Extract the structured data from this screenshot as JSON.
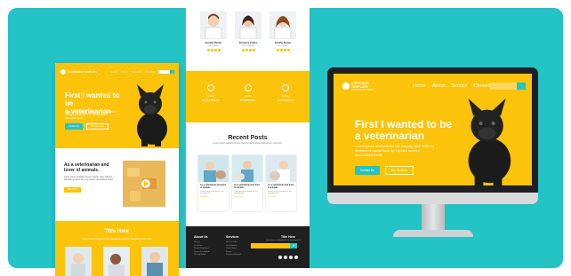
{
  "brand": {
    "name": "CUSTOMER TEMPLATE",
    "tagline": "VETERINARY CLINIC"
  },
  "nav": {
    "items": [
      "Home",
      "About",
      "Services",
      "Contact"
    ]
  },
  "hero": {
    "title_line1": "First I wanted to be",
    "title_line2": "a veterinarian",
    "description": "Lorem ipsum available but the majority have suffered alteration in some form, by injected humour randomised words",
    "primary_button": "Contact Us",
    "secondary_button": "Our Services"
  },
  "monitor_nav": {
    "items": [
      "Home",
      "About",
      "Service",
      "Contact"
    ]
  },
  "about": {
    "title_line1": "As a veterinarian and",
    "title_line2": "lover of animals.",
    "description": "Lorem ipsum available but the majority have suffered alteration in some form, by humour randomised words",
    "button": "Read More"
  },
  "services": {
    "title": "Title Here",
    "description": "Lorem ipsum available but the majority have suffered alteration in some form"
  },
  "team": [
    {
      "name": "Jennifer Becker",
      "role": "VETERINARY"
    },
    {
      "name": "Ginnanne Collins",
      "role": "VETERINARIAN"
    },
    {
      "name": "Jennifer Becker",
      "role": "VETERINARY"
    }
  ],
  "stats": [
    {
      "label": "CLIENT",
      "value": "Happy Clients"
    },
    {
      "label": "MEDIC",
      "value": "Experiences"
    },
    {
      "label": "PERFEC",
      "value": "Recruitment"
    }
  ],
  "posts": {
    "title": "Recent Posts",
    "subtitle": "Lorem ipsum available but the majority have suffered alteration in some form",
    "items": [
      {
        "title": "As a veterinarian and lover of animals",
        "text": "Lorem ipsum available but the majority have",
        "more": "Read More"
      },
      {
        "title": "As a veterinarian and lover of animals",
        "text": "Lorem ipsum available but the majority have",
        "more": "Read More"
      },
      {
        "title": "As a veterinarian and lover of animals",
        "text": "Lorem ipsum available but the majority have",
        "more": "Read More"
      }
    ]
  },
  "footer": {
    "col1_title": "About Us",
    "col1_items": [
      "History",
      "Our Team",
      "Brand Guidelines",
      "Terms & Condition",
      "Privacy Policy"
    ],
    "col2_title": "Services",
    "col2_items": [
      "How to Order",
      "Our Products",
      "Order Status",
      "Promo",
      "Payment Method"
    ],
    "col3_title": "Title Here",
    "col3_text": "Lorem ipsum available but the majority have"
  },
  "colors": {
    "accent": "#fbc30a",
    "teal": "#23c3c6",
    "dark": "#1f1f1f"
  }
}
